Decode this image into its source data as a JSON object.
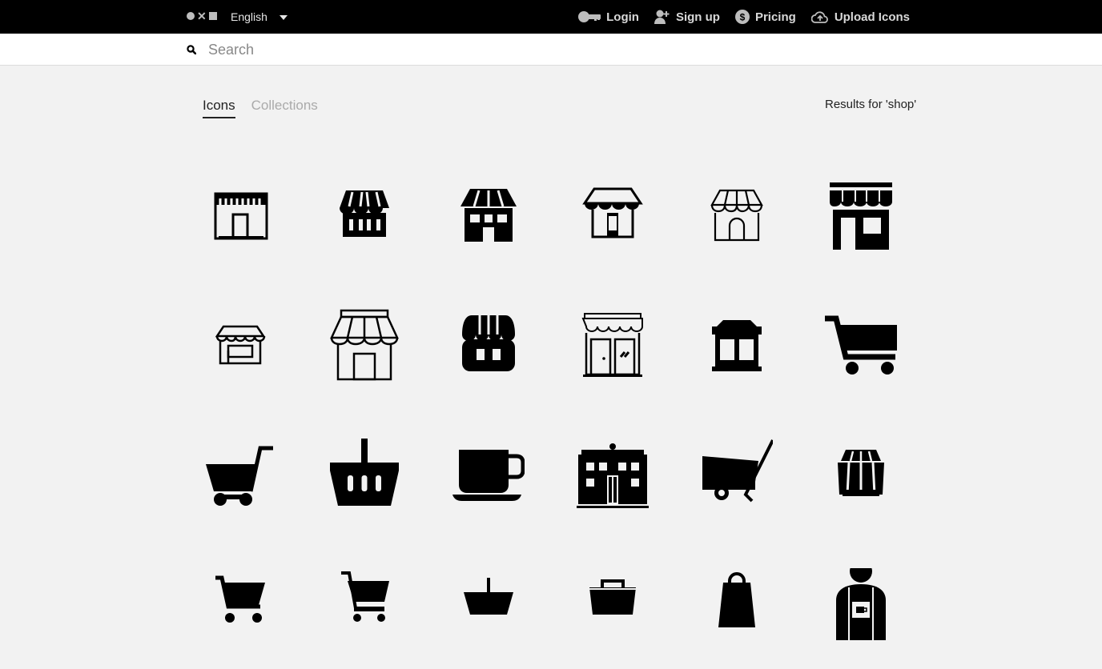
{
  "header": {
    "language": "English",
    "nav": [
      {
        "label": "Login",
        "icon": "key-icon"
      },
      {
        "label": "Sign up",
        "icon": "add-user-icon"
      },
      {
        "label": "Pricing",
        "icon": "dollar-icon"
      },
      {
        "label": "Upload Icons",
        "icon": "cloud-upload-icon"
      }
    ]
  },
  "search": {
    "placeholder": "Search",
    "value": ""
  },
  "tabs": [
    {
      "label": "Icons",
      "active": true
    },
    {
      "label": "Collections",
      "active": false
    }
  ],
  "results_text": "Results for 'shop'",
  "icons": [
    "storefront-outline-icon",
    "market-stall-icon",
    "shop-window-icon",
    "shop-awning-icon",
    "store-outline-icon",
    "store-icon",
    "small-shop-icon",
    "shop-front-icon",
    "store-awning-icon",
    "shop-doors-icon",
    "kiosk-icon",
    "shopping-cart-icon",
    "trolley-icon",
    "basket-icon",
    "coffee-cup-icon",
    "building-store-icon",
    "trailer-cart-icon",
    "market-stall-small-icon",
    "cart-icon",
    "cart-alt-icon",
    "basket-small-icon",
    "bag-tote-icon",
    "shopping-bag-icon",
    "shopkeeper-icon"
  ],
  "colors": {
    "topbar": "#000000",
    "background": "#f2f2f2"
  }
}
